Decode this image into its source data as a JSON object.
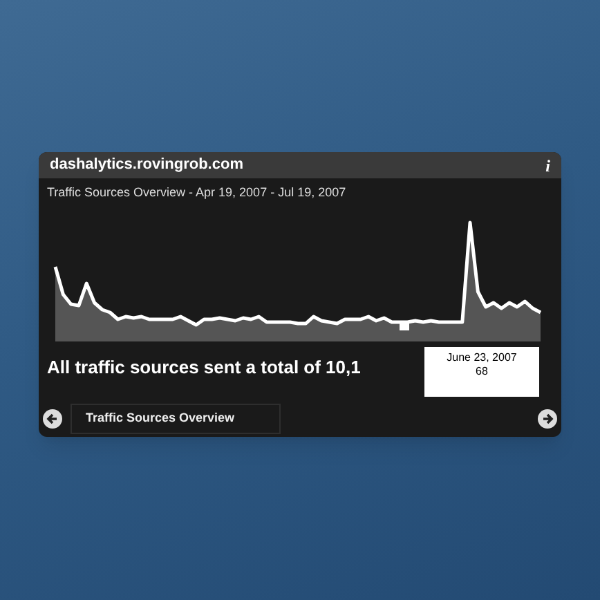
{
  "widget": {
    "title": "dashalytics.rovingrob.com",
    "info": "i",
    "subtitle": "Traffic Sources Overview - Apr 19, 2007 - Jul 19, 2007"
  },
  "summary": "All traffic sources sent a total of 10,1",
  "tooltip": {
    "date": "June 23, 2007",
    "value": "68"
  },
  "footer": {
    "tab": "Traffic Sources Overview"
  }
}
